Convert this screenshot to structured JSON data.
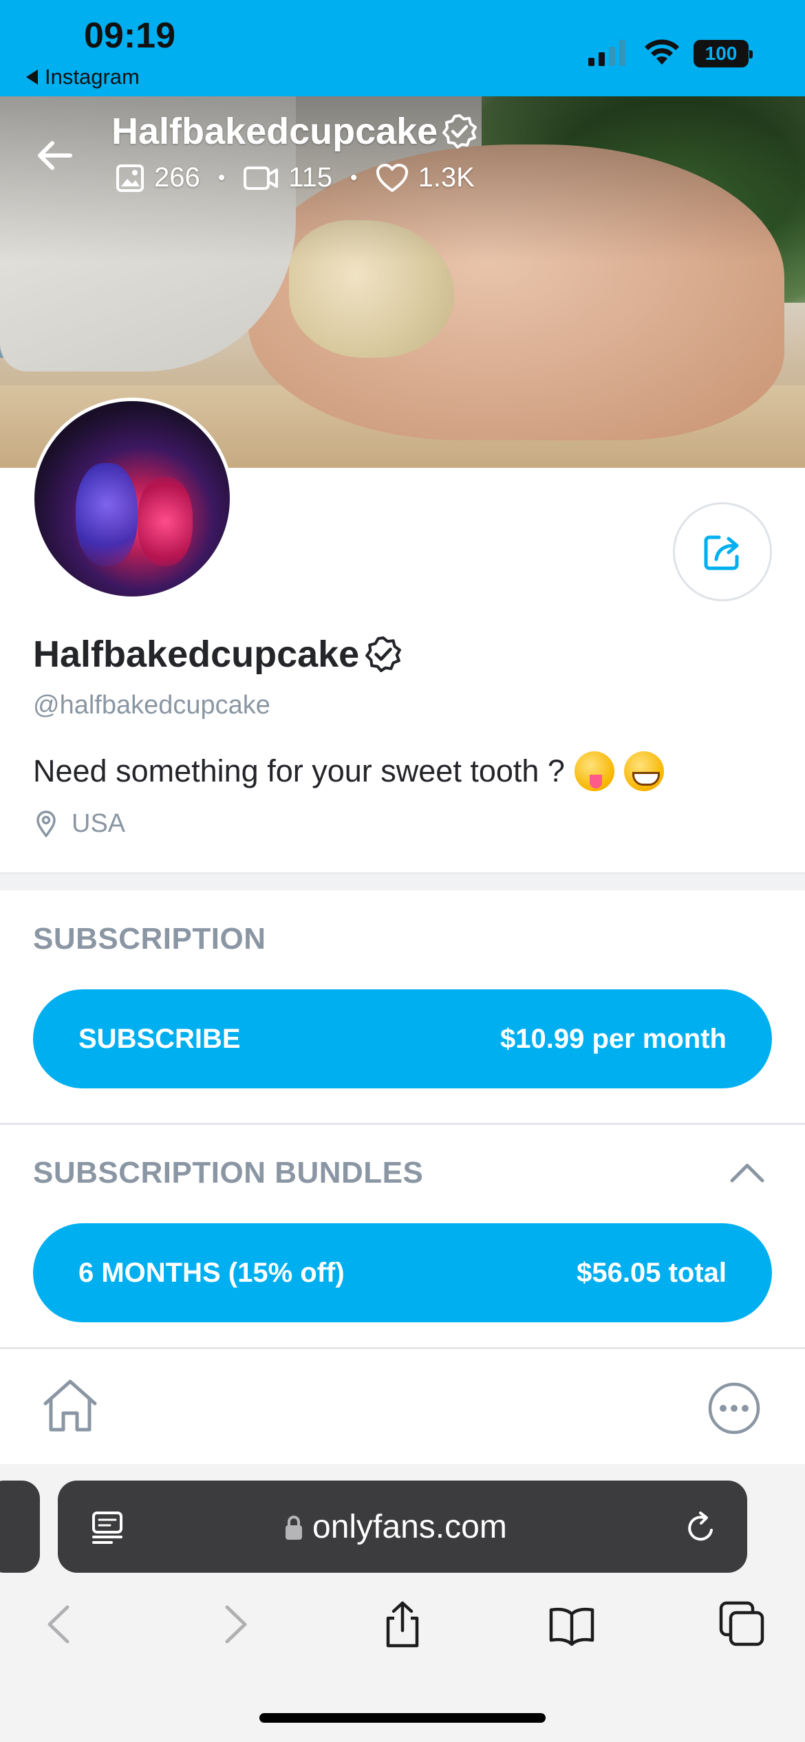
{
  "status_bar": {
    "time": "09:19",
    "back_app": "Instagram",
    "battery": "100"
  },
  "header": {
    "name": "Halfbakedcupcake",
    "stats": {
      "photos": "266",
      "videos": "115",
      "likes": "1.3K"
    }
  },
  "profile": {
    "name": "Halfbakedcupcake",
    "handle": "@halfbakedcupcake",
    "bio": "Need something for your sweet tooth ?",
    "location": "USA"
  },
  "subscription": {
    "title": "SUBSCRIPTION",
    "button_label": "SUBSCRIBE",
    "price": "$10.99 per month"
  },
  "bundles": {
    "title": "SUBSCRIPTION BUNDLES",
    "items": [
      {
        "label": "6 MONTHS (15% off)",
        "price": "$56.05 total"
      }
    ]
  },
  "browser": {
    "url": "onlyfans.com"
  },
  "colors": {
    "accent": "#00aff0",
    "muted": "#8a96a3",
    "text": "#242529"
  }
}
